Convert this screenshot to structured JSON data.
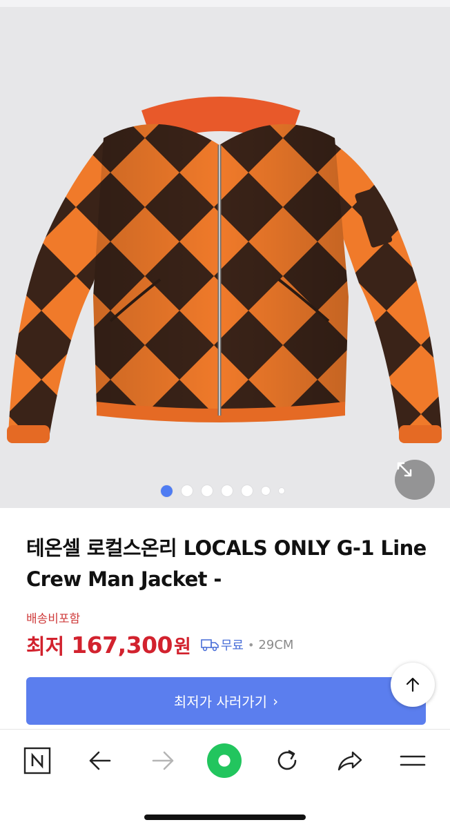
{
  "product": {
    "title": "테온셀 로컬스온리 LOCALS ONLY G-1 Line Crew Man Jacket -",
    "shipping_note": "배송비포함",
    "price_label": "최저",
    "price_value": "167,300",
    "price_unit": "원",
    "shipping_fee": "무료",
    "separator": "•",
    "store": "29CM"
  },
  "gallery": {
    "total_images": 7,
    "active_index": 0
  },
  "buttons": {
    "buy_label": "최저가 사러가기",
    "buy_chevron": "›"
  },
  "toolbar": {
    "items": [
      "naver-home",
      "back",
      "forward",
      "green-dot",
      "refresh",
      "share",
      "menu"
    ]
  },
  "colors": {
    "accent_blue": "#5b7eee",
    "price_red": "#d2222e",
    "shipping_red": "#cf3b3b",
    "jacket_orange": "#f07a2a",
    "jacket_brown": "#3a2318",
    "green": "#22c55e"
  }
}
